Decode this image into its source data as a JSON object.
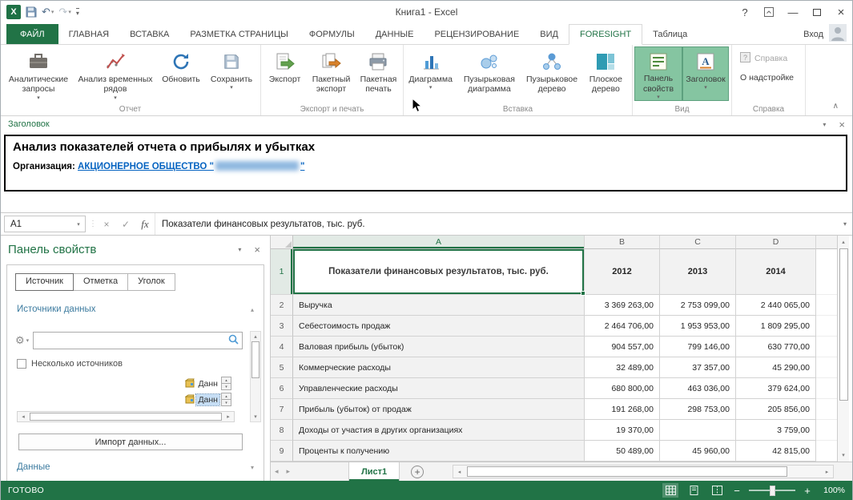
{
  "theme": {
    "excel_green": "#217346",
    "active_toggle": "#85C5A1",
    "link_blue": "#0563C1",
    "section_blue": "#3E7CA0",
    "selection_blue": "#C6DEF5"
  },
  "icons": {
    "caret": "▾",
    "caret_up": "▴",
    "chevron_up": "∧",
    "undo": "↶",
    "redo": "↷",
    "close": "×",
    "minimize": "—",
    "help": "?",
    "check": "✓",
    "dots": "⋮",
    "gear": "⚙",
    "left": "◂",
    "right": "▸",
    "plus": "+",
    "minus": "−"
  },
  "title_bar": {
    "title": "Книга1 - Excel"
  },
  "ribbon_tabs": {
    "file": "ФАЙЛ",
    "items": [
      "ГЛАВНАЯ",
      "ВСТАВКА",
      "РАЗМЕТКА СТРАНИЦЫ",
      "ФОРМУЛЫ",
      "ДАННЫЕ",
      "РЕЦЕНЗИРОВАНИЕ",
      "ВИД",
      "FORESIGHT",
      "Таблица"
    ],
    "active": "FORESIGHT",
    "sign_in": "Вход"
  },
  "ribbon": {
    "groups": {
      "report": "Отчет",
      "export_print": "Экспорт и печать",
      "insert": "Вставка",
      "view": "Вид",
      "help": "Справка"
    },
    "buttons": {
      "analytic_queries": "Аналитические запросы",
      "time_series": "Анализ временных рядов",
      "refresh": "Обновить",
      "save": "Сохранить",
      "export": "Экспорт",
      "batch_export": "Пакетный экспорт",
      "batch_print": "Пакетная печать",
      "chart": "Диаграмма",
      "bubble_chart": "Пузырьковая диаграмма",
      "bubble_tree": "Пузырьковое дерево",
      "flat_tree": "Плоское дерево",
      "properties_panel": "Панель свойств",
      "header": "Заголовок",
      "help": "Справка",
      "about": "О надстройке"
    }
  },
  "header_panel": {
    "title": "Заголовок",
    "report_title": "Анализ показателей отчета о прибылях и убытках",
    "org_label": "Организация:",
    "org_link_prefix": "АКЦИОНЕРНОЕ ОБЩЕСТВО \"",
    "org_link_suffix": "\""
  },
  "formula_bar": {
    "cell_ref": "A1",
    "fx": "fx",
    "content": "Показатели финансовых результатов, тыс. руб."
  },
  "properties_panel": {
    "title": "Панель свойств",
    "tabs": [
      {
        "label": "Источник"
      },
      {
        "label": "Отметка"
      },
      {
        "label": "Уголок"
      }
    ],
    "sources_header": "Источники данных",
    "multiple_sources": "Несколько источников",
    "items": [
      {
        "label": "Данн"
      },
      {
        "label": "Данн"
      }
    ],
    "import_button": "Импорт данных...",
    "data_header": "Данные"
  },
  "spreadsheet": {
    "col_headers": [
      "A",
      "B",
      "C",
      "D"
    ],
    "row_numbers": [
      "1",
      "2",
      "3",
      "4",
      "5",
      "6",
      "7",
      "8",
      "9"
    ],
    "header_row": {
      "a": "Показатели финансовых результатов, тыс. руб.",
      "b": "2012",
      "c": "2013",
      "d": "2014"
    },
    "rows": [
      {
        "label": "Выручка",
        "y2012": "3 369 263,00",
        "y2013": "2 753 099,00",
        "y2014": "2 440 065,00"
      },
      {
        "label": "Себестоимость продаж",
        "y2012": "2 464 706,00",
        "y2013": "1 953 953,00",
        "y2014": "1 809 295,00"
      },
      {
        "label": "Валовая прибыль (убыток)",
        "y2012": "904 557,00",
        "y2013": "799 146,00",
        "y2014": "630 770,00"
      },
      {
        "label": "Коммерческие расходы",
        "y2012": "32 489,00",
        "y2013": "37 357,00",
        "y2014": "45 290,00"
      },
      {
        "label": "Управленческие расходы",
        "y2012": "680 800,00",
        "y2013": "463 036,00",
        "y2014": "379 624,00"
      },
      {
        "label": "Прибыль (убыток) от продаж",
        "y2012": "191 268,00",
        "y2013": "298 753,00",
        "y2014": "205 856,00"
      },
      {
        "label": "Доходы от участия в других организациях",
        "y2012": "19 370,00",
        "y2013": "",
        "y2014": "3 759,00"
      },
      {
        "label": "Проценты к получению",
        "y2012": "50 489,00",
        "y2013": "45 960,00",
        "y2014": "42 815,00"
      }
    ]
  },
  "sheet_bar": {
    "tab": "Лист1"
  },
  "status_bar": {
    "state": "ГОТОВО",
    "zoom": "100%"
  }
}
